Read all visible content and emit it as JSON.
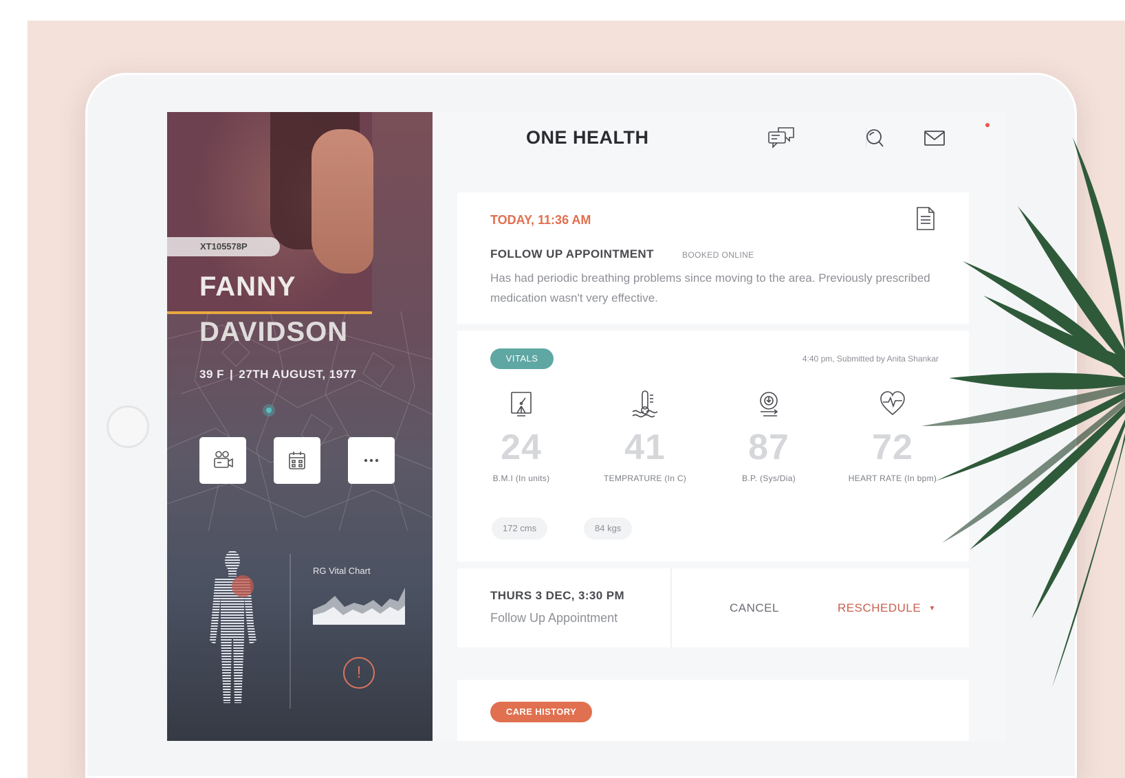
{
  "app": {
    "title": "ONE HEALTH"
  },
  "patient": {
    "id": "XT105578P",
    "first_name": "FANNY",
    "last_name": "DAVIDSON",
    "age_sex": "39 F",
    "dob": "27TH AUGUST, 1977"
  },
  "actions": [
    "video-call-icon",
    "calendar-icon",
    "more-icon"
  ],
  "vital_chart": {
    "label": "RG Vital Chart"
  },
  "appointment": {
    "time": "TODAY, 11:36 AM",
    "title": "FOLLOW UP APPOINTMENT",
    "booking": "BOOKED ONLINE",
    "description": "Has had periodic breathing problems since moving to the area. Previously prescribed medication wasn't very effective."
  },
  "vitals": {
    "badge": "VITALS",
    "submitted": "4:40 pm, Submitted by Anita Shankar",
    "items": [
      {
        "value": "24",
        "label": "B.M.I (In units)",
        "icon": "bmi-icon"
      },
      {
        "value": "41",
        "label": "TEMPRATURE (In C)",
        "icon": "thermometer-icon"
      },
      {
        "value": "87",
        "label": "B.P. (Sys/Dia)",
        "icon": "blood-pressure-icon"
      },
      {
        "value": "72",
        "label": "HEART RATE (In bpm)",
        "icon": "heart-rate-icon"
      }
    ],
    "height": "172 cms",
    "weight": "84 kgs"
  },
  "next_appointment": {
    "date": "THURS 3 DEC, 3:30 PM",
    "type": "Follow Up Appointment",
    "cancel": "CANCEL",
    "reschedule": "RESCHEDULE"
  },
  "care_history": {
    "badge": "CARE HISTORY"
  },
  "colors": {
    "accent_orange": "#e16f4e",
    "vitals_teal": "#5fa7a3",
    "reschedule": "#c95f4e",
    "backdrop": "#f3e1da"
  }
}
